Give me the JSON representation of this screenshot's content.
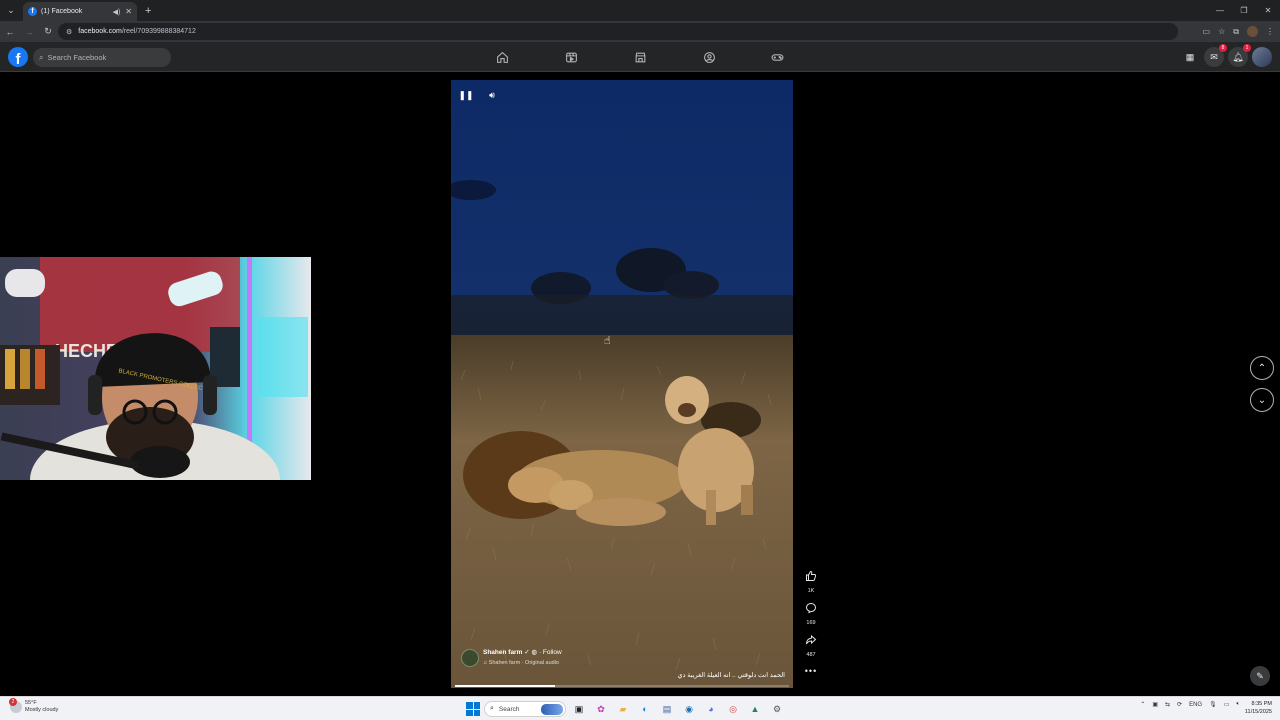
{
  "browser": {
    "tab_title": "(1) Facebook",
    "url_host": "facebook.com",
    "url_path": "/reel/709399888384712"
  },
  "facebook": {
    "search_placeholder": "Search Facebook",
    "messenger_badge": "8",
    "notifications_badge": "1"
  },
  "reel": {
    "author_name": "Shahen farm",
    "follow_label": "Follow",
    "audio_label": "Shahen farm · Original audio",
    "caption": "الحمد انت دلوقتي .. انه العيلة الغريبة دي",
    "progress": 0.3
  },
  "actions": {
    "likes": "1K",
    "comments": "169",
    "shares": "487"
  },
  "webcam": {
    "cap_text": "BLACK PROMOTERS COLLECTIVE",
    "backdrop_text": "HECHE"
  },
  "taskbar": {
    "weather_badge": "2",
    "temperature": "55°F",
    "weather_desc": "Mostly cloudy",
    "search_label": "Search",
    "language": "ENG",
    "time": "8:35 PM",
    "date": "11/15/2025"
  }
}
